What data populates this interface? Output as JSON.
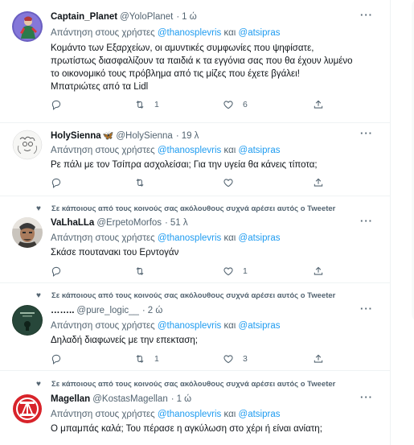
{
  "tweets": [
    {
      "social_context": "",
      "name": "Captain_Planet",
      "badge": "",
      "handle": "@YoloPlanet",
      "separator": "·",
      "time": "1 ώ",
      "reply_prefix": "Απάντηση στους χρήστες",
      "mention1": "@thanosplevris",
      "reply_and": "και",
      "mention2": "@atsipras",
      "text_lines": [
        "Κομάντο των Εξαρχείων, οι αμυντικές συμφωνίες που ψηφίσατε,",
        "πρωτίστως διασφαλίζουν τα παιδιά κ τα εγγόνια σας που θα έχουν λυμένο",
        "το οικονομικό τους πρόβλημα από τις μίζες που έχετε βγάλει!",
        "Μπατριώτες από τα Lidl"
      ],
      "replies": "",
      "retweets": "1",
      "likes": "6",
      "avatar_icon": "superhero-avatar"
    },
    {
      "social_context": "",
      "name": "HolySienna",
      "badge": "🦋",
      "handle": "@HolySienna",
      "separator": "·",
      "time": "19 λ",
      "reply_prefix": "Απάντηση στους χρήστες",
      "mention1": "@thanosplevris",
      "reply_and": "και",
      "mention2": "@atsipras",
      "text_lines": [
        "Ρε πάλι με τον Τσίπρα ασχολείσαι; Για την υγεία θα κάνεις τίποτα;"
      ],
      "replies": "",
      "retweets": "",
      "likes": "",
      "avatar_icon": "line-art-avatar"
    },
    {
      "social_context": "Σε κάποιους από τους κοινούς σας ακόλουθους συχνά αρέσει αυτός ο Tweeter",
      "name": "VaLhaLLa",
      "badge": "",
      "handle": "@ErpetoMorfos",
      "separator": "·",
      "time": "51 λ",
      "reply_prefix": "Απάντηση στους χρήστες",
      "mention1": "@thanosplevris",
      "reply_and": "και",
      "mention2": "@atsipras",
      "text_lines": [
        "Σκάσε πουτανακι του Ερντογάν"
      ],
      "replies": "",
      "retweets": "",
      "likes": "1",
      "avatar_icon": "warrior-avatar"
    },
    {
      "social_context": "Σε κάποιους από τους κοινούς σας ακόλουθους συχνά αρέσει αυτός ο Tweeter",
      "name": "……..",
      "badge": "",
      "handle": "@pure_logic__",
      "separator": "·",
      "time": "2 ώ",
      "reply_prefix": "Απάντηση στους χρήστες",
      "mention1": "@thanosplevris",
      "reply_and": "και",
      "mention2": "@atsipras",
      "text_lines": [
        "Δηλαδή διαφωνείς με την επεκταση;"
      ],
      "replies": "",
      "retweets": "1",
      "likes": "3",
      "avatar_icon": "dark-green-avatar"
    },
    {
      "social_context": "Σε κάποιους από τους κοινούς σας ακόλουθους συχνά αρέσει αυτός ο Tweeter",
      "name": "Magellan",
      "badge": "",
      "handle": "@KostasMagellan",
      "separator": "·",
      "time": "1 ώ",
      "reply_prefix": "Απάντηση στους χρήστες",
      "mention1": "@thanosplevris",
      "reply_and": "και",
      "mention2": "@atsipras",
      "text_lines": [
        "Ο μπαμπάς καλά; Του πέρασε η αγκύλωση στο χέρι ή είναι ανίατη;"
      ],
      "replies": "",
      "retweets": "",
      "likes": "",
      "avatar_icon": "red-emblem-avatar"
    }
  ],
  "icons": {
    "reply": "reply-icon",
    "retweet": "retweet-icon",
    "like": "like-icon",
    "share": "share-icon",
    "more": "more-icon",
    "social_heart": "heart-icon"
  },
  "colors": {
    "accent": "#1d9bf0",
    "secondary_text": "#536471",
    "primary_text": "#0f1419",
    "divider": "#eff3f4"
  }
}
